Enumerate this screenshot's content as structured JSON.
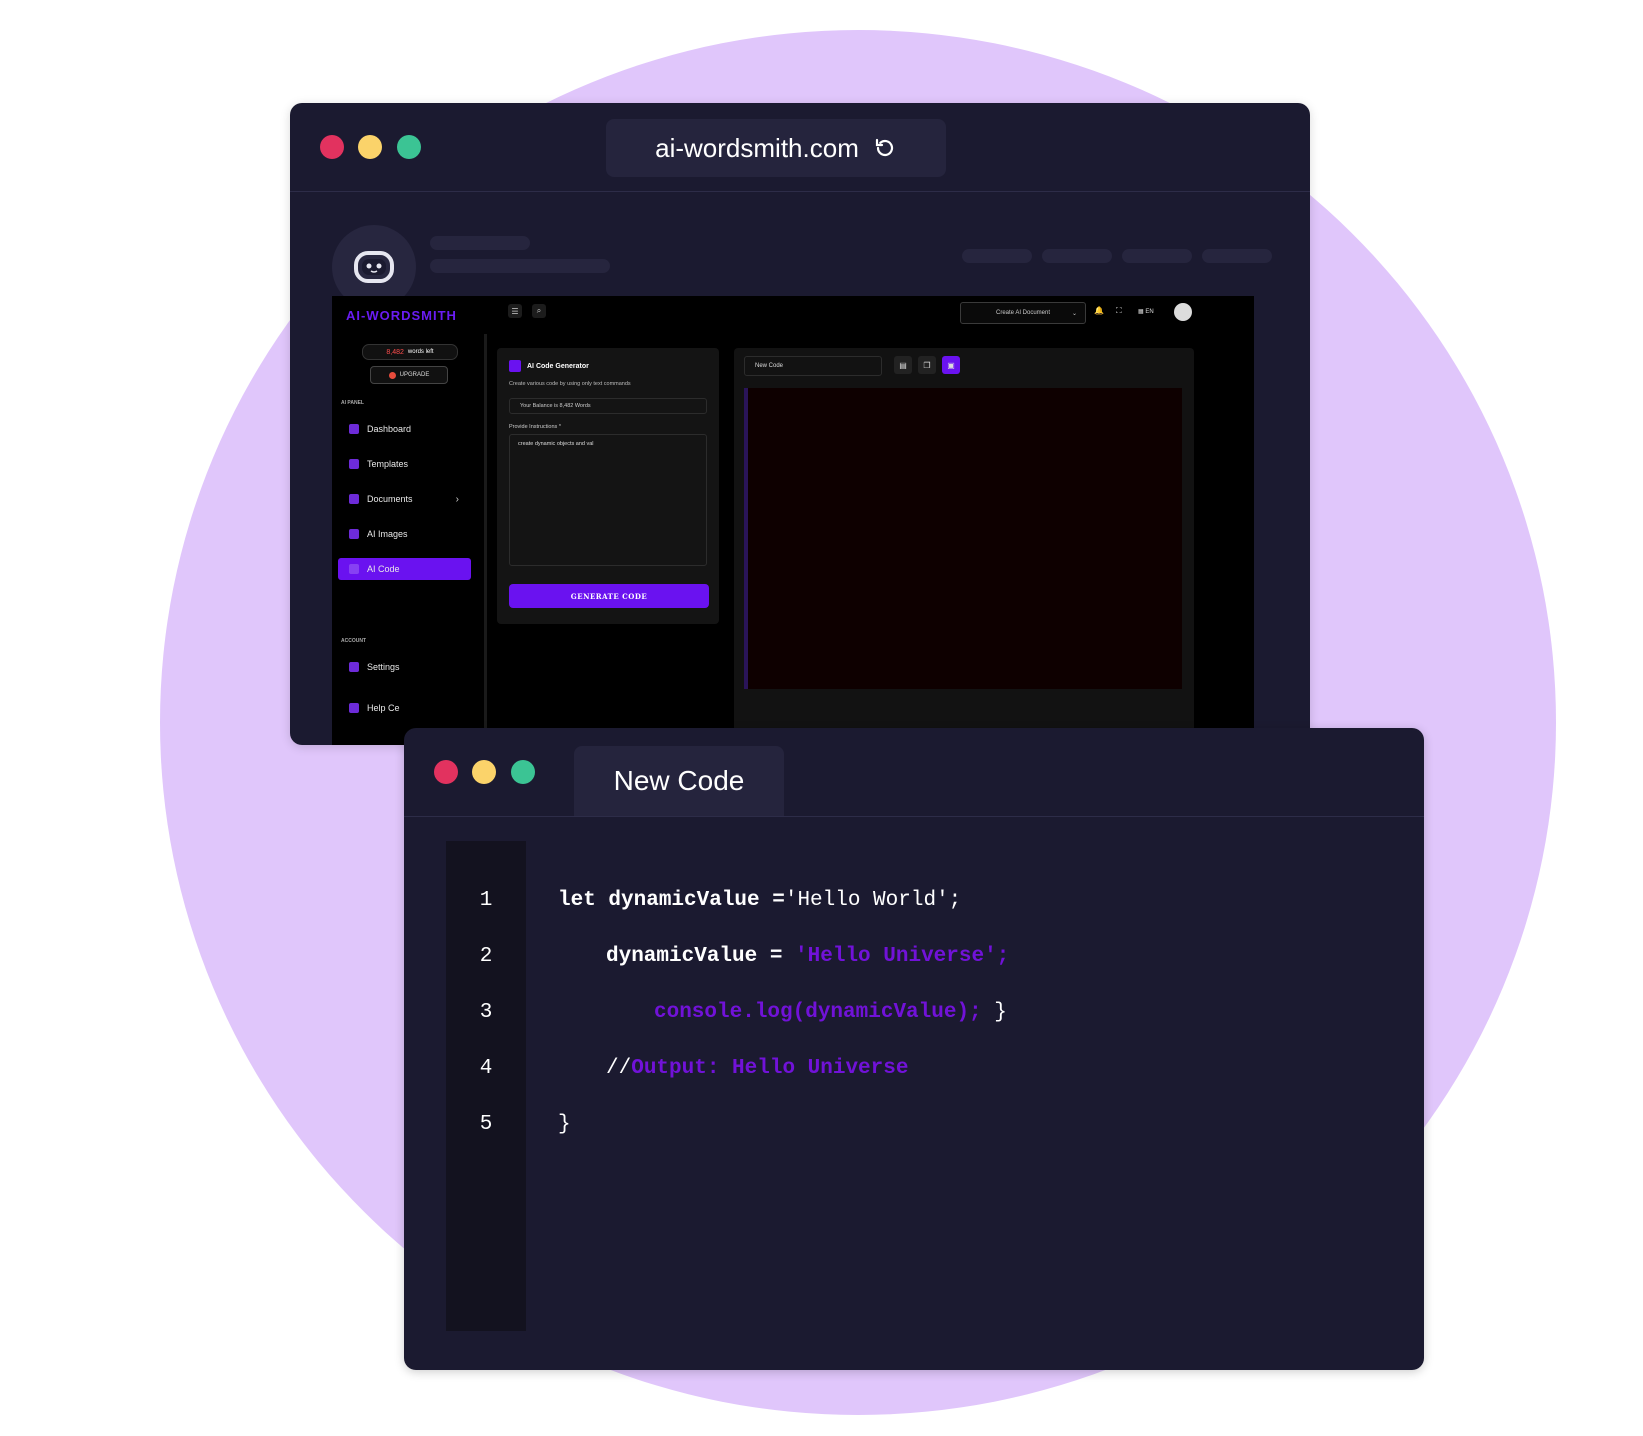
{
  "browser": {
    "url": "ai-wordsmith.com"
  },
  "app": {
    "logo": "AI-WORDSMITH",
    "words_left": {
      "count": "8,482",
      "label": "words left"
    },
    "upgrade_label": "UPGRADE",
    "section_ai_panel": "AI PANEL",
    "nav": [
      {
        "label": "Dashboard",
        "icon": "dashboard-icon"
      },
      {
        "label": "Templates",
        "icon": "templates-icon"
      },
      {
        "label": "Documents",
        "icon": "documents-icon"
      },
      {
        "label": "AI Images",
        "icon": "image-icon"
      },
      {
        "label": "AI Code",
        "icon": "code-icon",
        "active": true
      }
    ],
    "section_account": "ACCOUNT",
    "account_nav": [
      {
        "label": "Settings",
        "icon": "gear-icon"
      },
      {
        "label": "Help Ce",
        "icon": "help-icon"
      }
    ],
    "header": {
      "document_select": "Create AI Document",
      "language": "EN"
    },
    "generator": {
      "title": "AI Code Generator",
      "subtitle": "Create various code by using only text commands",
      "balance": "Your Balance is 8,482 Words",
      "instructions_label": "Provide Instructions *",
      "instructions_value": "create dynamic objects and val",
      "button": "GENERATE CODE"
    },
    "code_panel": {
      "name_value": "New Code"
    }
  },
  "editor": {
    "tab_title": "New Code",
    "line_numbers": [
      "1",
      "2",
      "3",
      "4",
      "5"
    ],
    "lines": {
      "l1_kw": "let dynamicValue =",
      "l1_str": "'Hello World';",
      "l2_kw": "dynamicValue =",
      "l2_str": "'Hello Universe';",
      "l3_code": "console.log(dynamicValue);",
      "l3_end": "}",
      "l4_prefix": "//",
      "l4_comment": "Output: Hello Universe",
      "l5": "}"
    }
  },
  "colors": {
    "background_circle": "#e0c6fb",
    "window": "#1b1a30",
    "accent": "#6a12f0",
    "code_purple": "#7112d8",
    "dot_red": "#e2325f",
    "dot_yellow": "#fbd36a",
    "dot_green": "#3bc494"
  }
}
